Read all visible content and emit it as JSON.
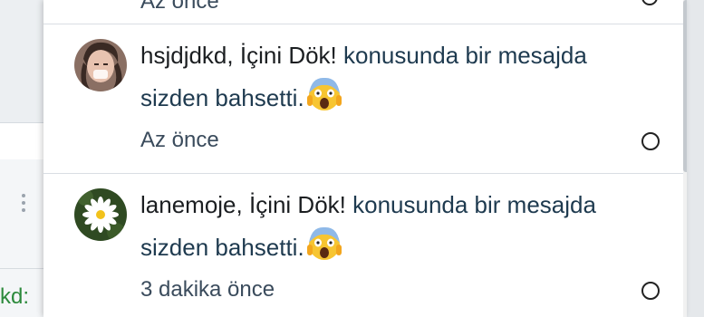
{
  "background": {
    "partial_text": "kd:"
  },
  "popup": {
    "previous_time": "Az önce",
    "notifications": [
      {
        "username": "hsjdjdkd",
        "separator": ", ",
        "topic": "İçini Dök!",
        "message": " konusunda bir mesajda sizden bahsetti.",
        "time": "Az önce",
        "avatar": "avatar-person-icon"
      },
      {
        "username": "lanemoje",
        "separator": ", ",
        "topic": "İçini Dök!",
        "message": " konusunda bir mesajda sizden bahsetti.",
        "time": "3 dakika önce",
        "avatar": "avatar-flower-icon"
      }
    ]
  },
  "colors": {
    "link_text": "#1e3a4f",
    "time_text": "#3a4b5c",
    "green_text": "#2c8a3c"
  }
}
